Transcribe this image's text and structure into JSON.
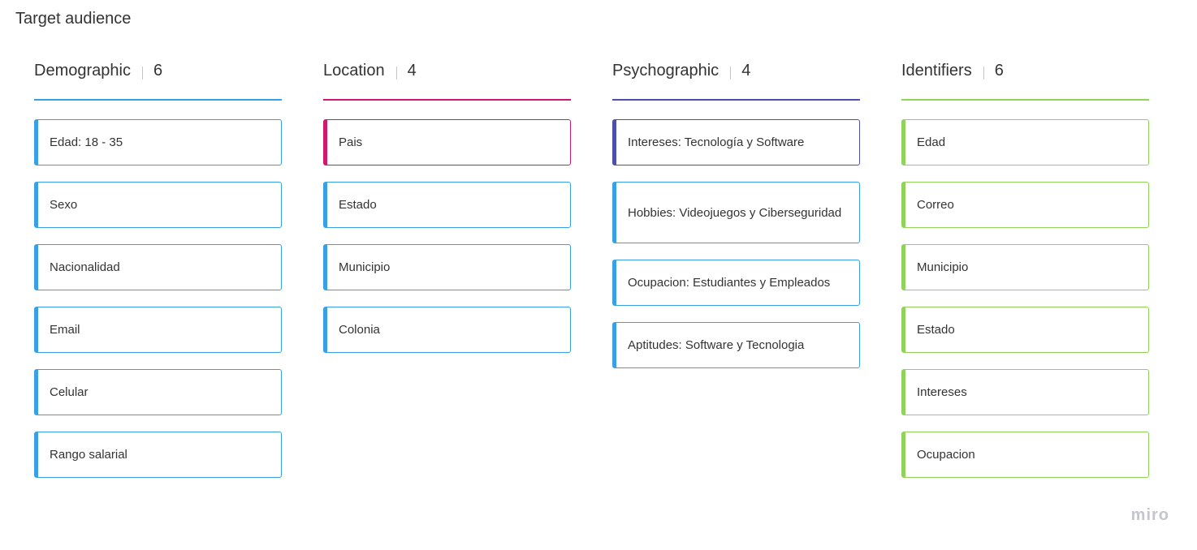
{
  "board": {
    "title": "Target audience"
  },
  "columns": [
    {
      "name": "Demographic",
      "count": "6",
      "line_color": "#3aa0e6",
      "card_border": "#3aa0e6",
      "card_accent": "#3aa0e6",
      "cards": [
        "Edad: 18 - 35",
        "Sexo",
        "Nacionalidad",
        "Email",
        "Celular",
        "Rango salarial"
      ]
    },
    {
      "name": "Location",
      "count": "4",
      "line_color": "#d0196b",
      "card_border": "#3aa0e6",
      "card_accent": "#3aa0e6",
      "first_card_border": "#d0196b",
      "cards": [
        "Pais",
        "Estado",
        "Municipio",
        "Colonia"
      ]
    },
    {
      "name": "Psychographic",
      "count": "4",
      "line_color": "#4c4fae",
      "card_border": "#3aa0e6",
      "card_accent": "#3aa0e6",
      "first_card_border": "#4c4fae",
      "cards": [
        "Intereses: Tecnología y Software",
        "Hobbies: Videojuegos y Ciberseguridad",
        "Ocupacion: Estudiantes y Empleados",
        "Aptitudes: Software y Tecnologia"
      ]
    },
    {
      "name": "Identifiers",
      "count": "6",
      "line_color": "#8fd35a",
      "card_border": "#8fd35a",
      "card_accent": "#8fd35a",
      "cards": [
        "Edad",
        "Correo",
        "Municipio",
        "Estado",
        "Intereses",
        "Ocupacion"
      ]
    }
  ],
  "footer": {
    "logo_text": "miro"
  }
}
